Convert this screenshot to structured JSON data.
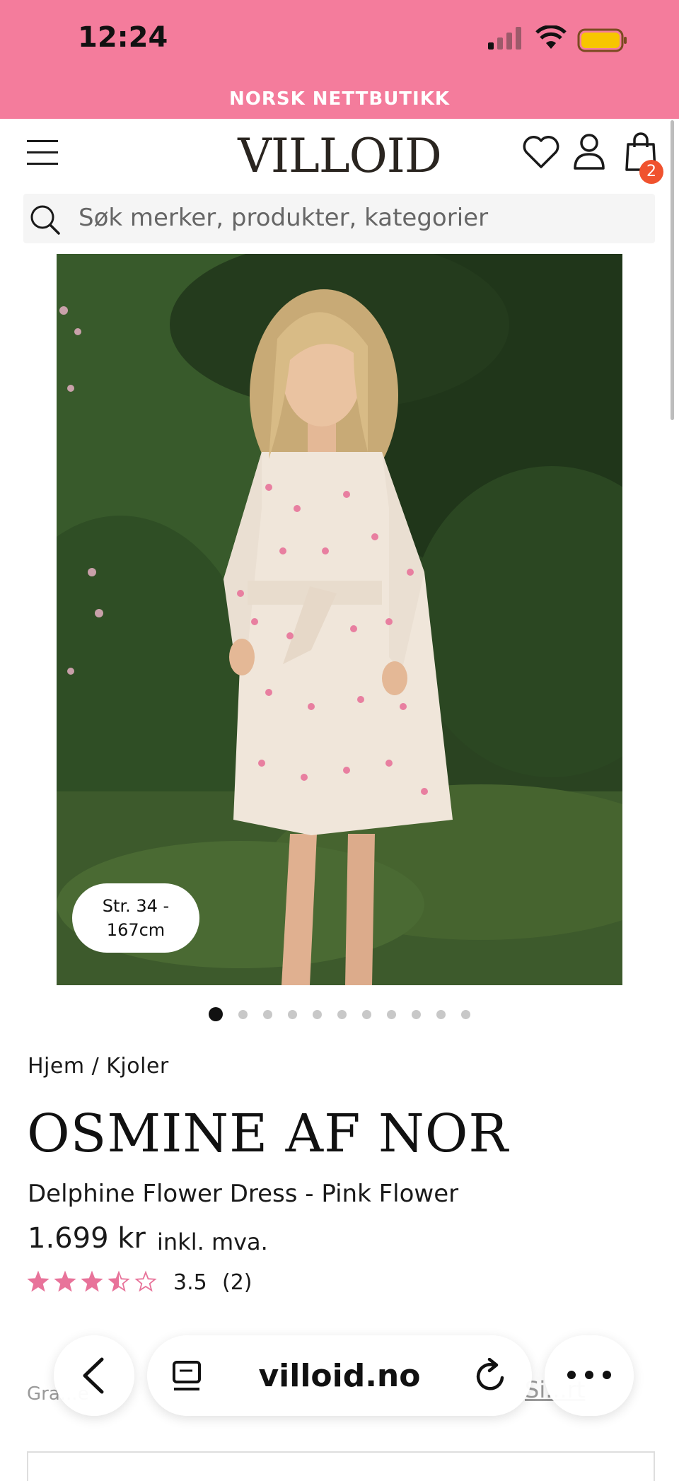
{
  "status_bar": {
    "time": "12:24",
    "signal_icon": "signal-bars-icon",
    "wifi_icon": "wifi-icon",
    "battery_icon": "battery-icon"
  },
  "announcement": "NORSK NETTBUTIKK",
  "header": {
    "logo": "VILLOID",
    "cart_count": "2",
    "icons": [
      "menu-icon",
      "heart-icon",
      "user-icon",
      "shopping-bag-icon"
    ]
  },
  "search": {
    "placeholder": "Søk merker, produkter, kategorier"
  },
  "gallery": {
    "size_label_line1": "Str. 34 -",
    "size_label_line2": "167cm",
    "image_count": 11,
    "active_index": 0
  },
  "product": {
    "breadcrumb": "Hjem / Kjoler",
    "brand": "OSMINE AF NOR",
    "name": "Delphine Flower Dress - Pink Flower",
    "price": "1.699 kr",
    "vat_note": "inkl. mva.",
    "rating": "3.5",
    "rating_value": 3.5,
    "review_count": "(2)"
  },
  "below_fold": {
    "left_text": "Gra...e",
    "right_link": "Si...rt"
  },
  "browser": {
    "url": "villoid.no"
  },
  "colors": {
    "brand_pink": "#f47c9c",
    "badge_orange": "#f0522e",
    "star_pink": "#e8739a"
  }
}
